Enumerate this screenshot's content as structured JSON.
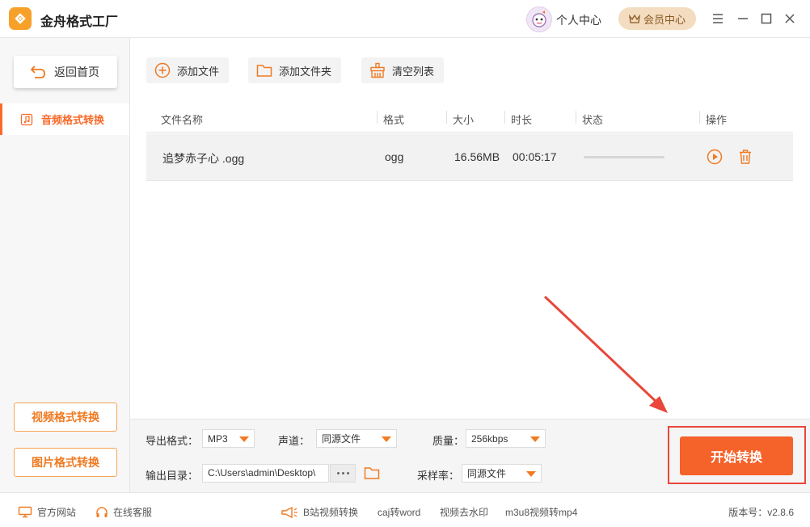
{
  "app": {
    "title": "金舟格式工厂"
  },
  "header": {
    "user_center": "个人中心",
    "vip_label": "会员中心"
  },
  "sidebar": {
    "back_label": "返回首页",
    "active_item": "音频格式转换",
    "bottom_items": [
      "视频格式转换",
      "图片格式转换"
    ]
  },
  "toolbar": {
    "add_file": "添加文件",
    "add_folder": "添加文件夹",
    "clear_list": "清空列表"
  },
  "table": {
    "columns": [
      "文件名称",
      "格式",
      "大小",
      "时长",
      "状态",
      "操作"
    ],
    "rows": [
      {
        "name": "追梦赤子心 .ogg",
        "format": "ogg",
        "size": "16.56MB",
        "duration": "00:05:17",
        "progress": 0.0
      }
    ]
  },
  "settings": {
    "export_format_label": "导出格式：",
    "export_format_value": "MP3",
    "channel_label": "声道：",
    "channel_value": "同源文件",
    "quality_label": "质量：",
    "quality_value": "256kbps",
    "output_dir_label": "输出目录：",
    "output_dir_value": "C:\\Users\\admin\\Desktop\\",
    "sample_rate_label": "采样率：",
    "sample_rate_value": "同源文件"
  },
  "start_button": "开始转换",
  "footer": {
    "official_site": "官方网站",
    "online_service": "在线客服",
    "links": [
      "B站视频转换",
      "caj转word",
      "视频去水印",
      "m3u8视频转mp4"
    ],
    "version": "版本号：v2.8.6"
  },
  "colors": {
    "accent": "#f5622a",
    "highlight_frame": "#e8473a",
    "vip_bg": "#f3dcc0"
  }
}
